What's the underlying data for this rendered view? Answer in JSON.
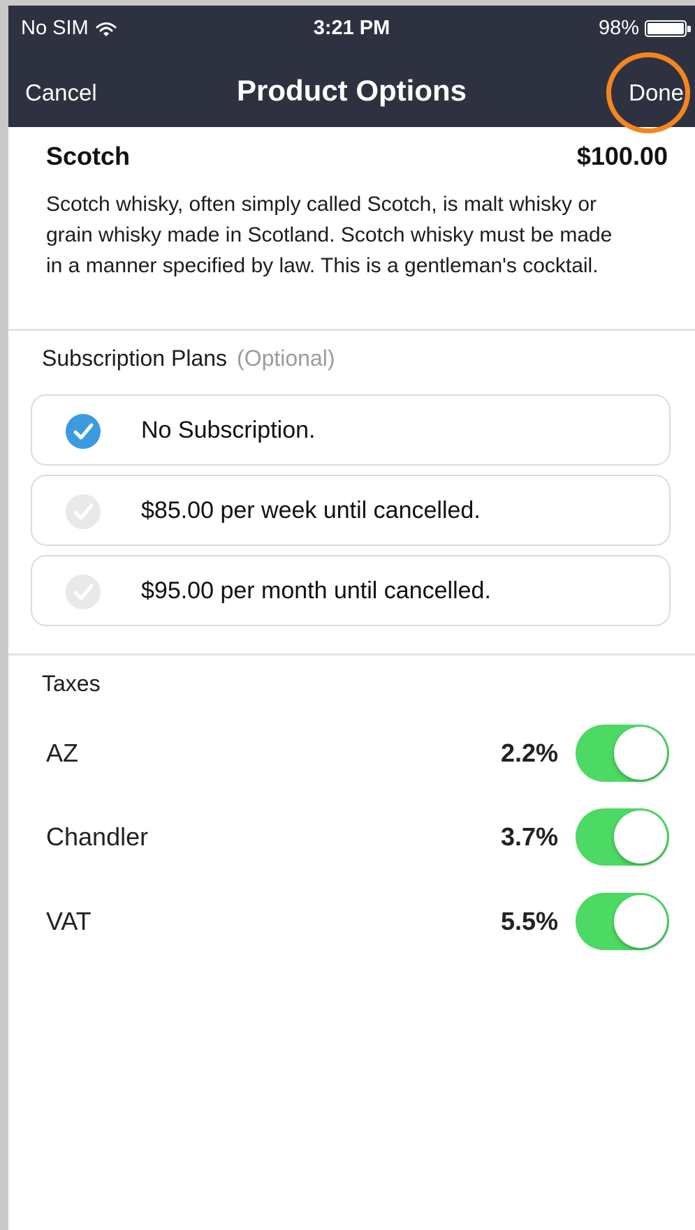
{
  "status_bar": {
    "carrier": "No SIM",
    "time": "3:21 PM",
    "battery": "98%"
  },
  "nav": {
    "cancel_label": "Cancel",
    "title": "Product Options",
    "done_label": "Done",
    "highlight_color": "#f6851f"
  },
  "product": {
    "name": "Scotch",
    "price": "$100.00",
    "description": "Scotch whisky, often simply called Scotch, is malt whisky or grain whisky made in Scotland. Scotch whisky must be made in a manner specified by law. This is a gentleman's cocktail."
  },
  "subscriptions": {
    "heading": "Subscription Plans",
    "optional_note": "(Optional)",
    "plans": [
      {
        "label": "No Subscription.",
        "selected": true
      },
      {
        "label": "$85.00 per week until cancelled.",
        "selected": false
      },
      {
        "label": "$95.00 per month until cancelled.",
        "selected": false
      }
    ]
  },
  "taxes": {
    "heading": "Taxes",
    "items": [
      {
        "name": "AZ",
        "rate": "2.2%",
        "enabled": true
      },
      {
        "name": "Chandler",
        "rate": "3.7%",
        "enabled": true
      },
      {
        "name": "VAT",
        "rate": "5.5%",
        "enabled": true
      }
    ]
  },
  "colors": {
    "header_bg": "#2e3240",
    "check_selected": "#3c9be0",
    "toggle_on": "#4cd964"
  },
  "icons": {
    "wifi": "wifi-icon",
    "battery": "battery-icon",
    "check": "checkmark-icon"
  }
}
